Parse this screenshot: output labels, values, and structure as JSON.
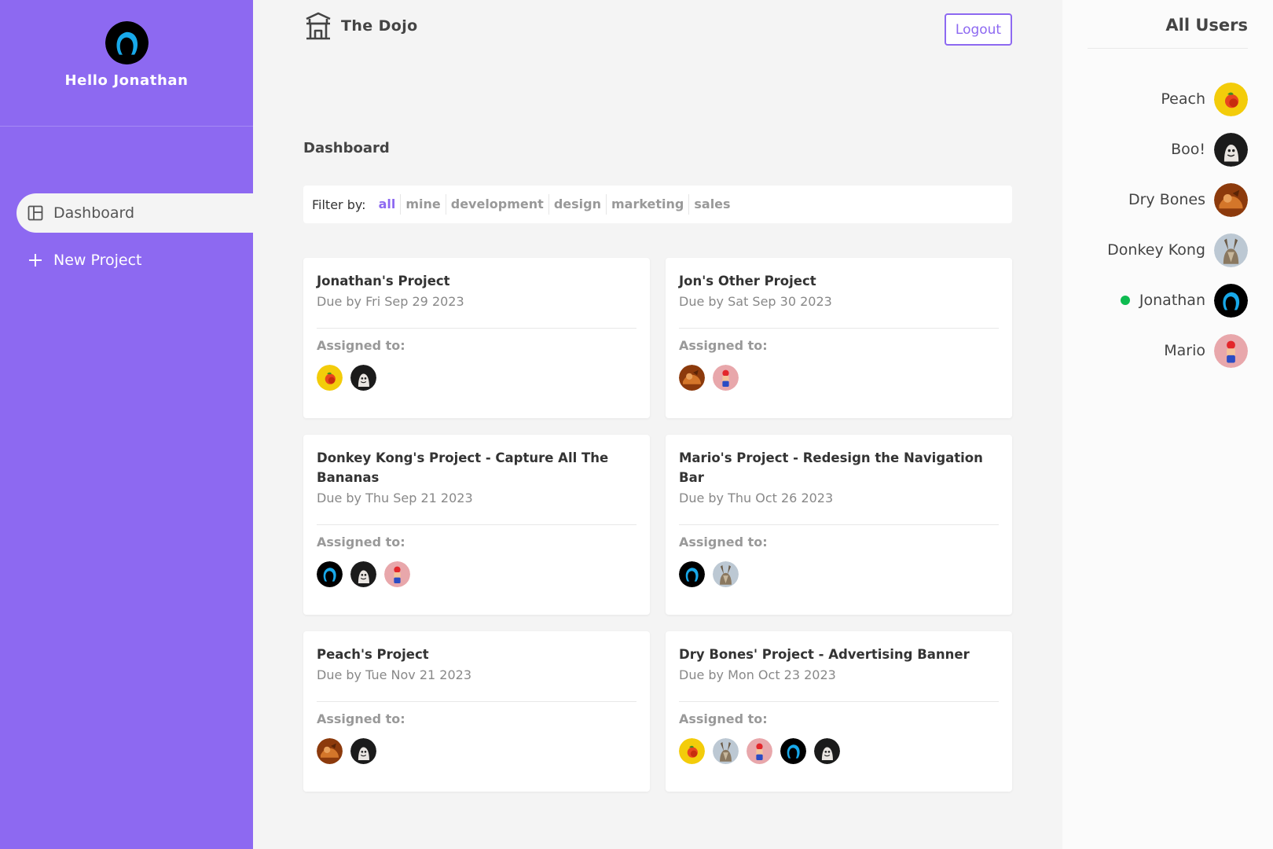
{
  "sidebar": {
    "greeting": "Hello Jonathan",
    "avatar": "jonathan",
    "nav": [
      {
        "label": "Dashboard",
        "icon": "dashboard-icon",
        "active": true
      },
      {
        "label": "New Project",
        "icon": "plus-icon",
        "active": false
      }
    ]
  },
  "header": {
    "brand_name": "The Dojo",
    "brand_icon": "temple-icon",
    "logout_label": "Logout"
  },
  "main": {
    "title": "Dashboard",
    "filter_label": "Filter by:",
    "filters": [
      "all",
      "mine",
      "development",
      "design",
      "marketing",
      "sales"
    ],
    "active_filter": "all",
    "assigned_label": "Assigned to:",
    "projects": [
      {
        "title": "Jonathan's Project",
        "due": "Due by Fri Sep 29 2023",
        "assigned": [
          "peach",
          "boo"
        ]
      },
      {
        "title": "Jon's Other Project",
        "due": "Due by Sat Sep 30 2023",
        "assigned": [
          "drybones",
          "mario"
        ]
      },
      {
        "title": "Donkey Kong's Project - Capture All The Bananas",
        "due": "Due by Thu Sep 21 2023",
        "assigned": [
          "jonathan",
          "boo",
          "mario"
        ]
      },
      {
        "title": "Mario's Project - Redesign the Navigation Bar",
        "due": "Due by Thu Oct 26 2023",
        "assigned": [
          "jonathan",
          "donkeykong"
        ]
      },
      {
        "title": "Peach's Project",
        "due": "Due by Tue Nov 21 2023",
        "assigned": [
          "drybones",
          "boo"
        ]
      },
      {
        "title": "Dry Bones' Project - Advertising Banner",
        "due": "Due by Mon Oct 23 2023",
        "assigned": [
          "peach",
          "donkeykong",
          "mario",
          "jonathan",
          "boo"
        ]
      }
    ]
  },
  "users_panel": {
    "title": "All Users",
    "users": [
      {
        "name": "Peach",
        "avatar": "peach",
        "online": false
      },
      {
        "name": "Boo!",
        "avatar": "boo",
        "online": false
      },
      {
        "name": "Dry Bones",
        "avatar": "drybones",
        "online": false
      },
      {
        "name": "Donkey Kong",
        "avatar": "donkeykong",
        "online": false
      },
      {
        "name": "Jonathan",
        "avatar": "jonathan",
        "online": true
      },
      {
        "name": "Mario",
        "avatar": "mario",
        "online": false
      }
    ]
  },
  "colors": {
    "accent": "#8d69f1",
    "online": "#0ebb50",
    "background": "#f4f4f4"
  }
}
